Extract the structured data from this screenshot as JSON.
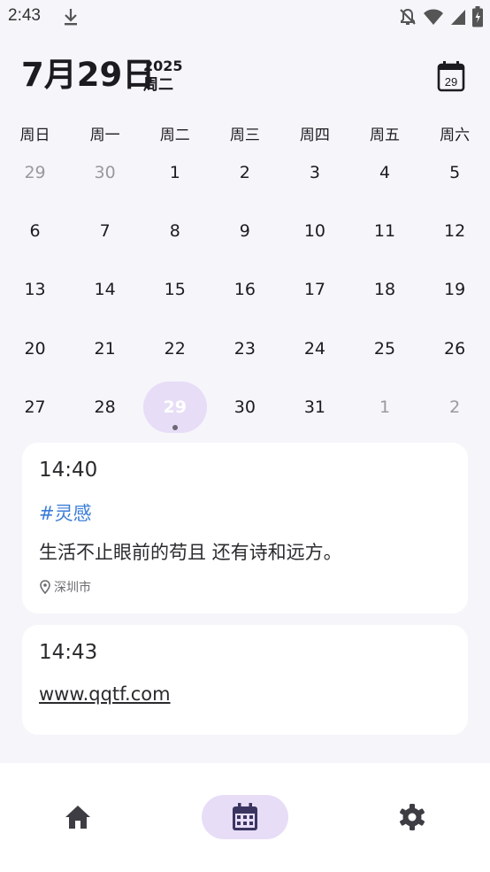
{
  "status_bar": {
    "time": "2:43"
  },
  "header": {
    "date": "7月29日",
    "year": "2025",
    "weekday": "周二",
    "calendar_button_day": "29"
  },
  "weekdays": [
    "周日",
    "周一",
    "周二",
    "周三",
    "周四",
    "周五",
    "周六"
  ],
  "calendar": {
    "days": [
      {
        "label": "29",
        "muted": true
      },
      {
        "label": "30",
        "muted": true
      },
      {
        "label": "1"
      },
      {
        "label": "2"
      },
      {
        "label": "3"
      },
      {
        "label": "4"
      },
      {
        "label": "5"
      },
      {
        "label": "6"
      },
      {
        "label": "7"
      },
      {
        "label": "8"
      },
      {
        "label": "9"
      },
      {
        "label": "10"
      },
      {
        "label": "11"
      },
      {
        "label": "12"
      },
      {
        "label": "13"
      },
      {
        "label": "14"
      },
      {
        "label": "15"
      },
      {
        "label": "16"
      },
      {
        "label": "17"
      },
      {
        "label": "18"
      },
      {
        "label": "19"
      },
      {
        "label": "20"
      },
      {
        "label": "21"
      },
      {
        "label": "22"
      },
      {
        "label": "23"
      },
      {
        "label": "24"
      },
      {
        "label": "25"
      },
      {
        "label": "26"
      },
      {
        "label": "27"
      },
      {
        "label": "28"
      },
      {
        "label": "29",
        "selected": true,
        "has_entry": true
      },
      {
        "label": "30"
      },
      {
        "label": "31"
      },
      {
        "label": "1",
        "muted": true
      },
      {
        "label": "2",
        "muted": true
      }
    ]
  },
  "entries": [
    {
      "time": "14:40",
      "tag": "#灵感",
      "text": "生活不止眼前的苟且 还有诗和远方。",
      "location": "深圳市"
    },
    {
      "time": "14:43",
      "link": "www.qqtf.com"
    }
  ],
  "colors": {
    "accent_pill": "#e7ddf7",
    "tag": "#3b7dd8",
    "background": "#f6f5fa",
    "card": "#ffffff"
  },
  "bottom_nav": {
    "items": [
      "home-icon",
      "calendar-icon",
      "settings-icon"
    ],
    "active": "calendar-icon"
  }
}
